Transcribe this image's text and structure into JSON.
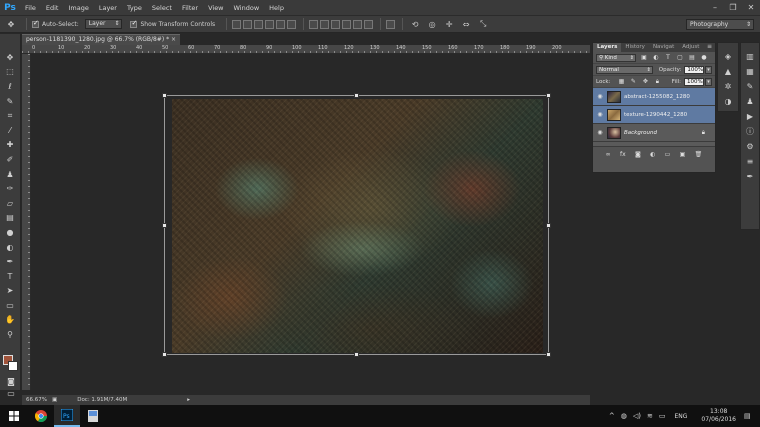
{
  "app": {
    "logo": "Ps"
  },
  "menu": [
    "File",
    "Edit",
    "Image",
    "Layer",
    "Type",
    "Select",
    "Filter",
    "View",
    "Window",
    "Help"
  ],
  "window_controls": [
    "–",
    "❐",
    "✕"
  ],
  "options_bar": {
    "auto_select_label": "Auto-Select:",
    "auto_select_target": "Layer",
    "show_transform_label": "Show Transform Controls",
    "workspace": "Photography"
  },
  "document": {
    "tab_title": "person-1181390_1280.jpg @ 66.7% (RGB/8#) *",
    "close": "×"
  },
  "ruler_numbers": [
    "0",
    "10",
    "20",
    "30",
    "40",
    "50",
    "60",
    "70",
    "80",
    "90",
    "100",
    "110",
    "120",
    "130",
    "140",
    "150",
    "160",
    "170",
    "180",
    "190",
    "200"
  ],
  "status": {
    "zoom": "66.67%",
    "doc_size": "Doc: 1.91M/7.40M"
  },
  "layers_panel": {
    "tabs": [
      "Layers",
      "History",
      "Navigat",
      "Adjust"
    ],
    "filter_kind": "Kind",
    "blend_mode": "Normal",
    "opacity_label": "Opacity:",
    "opacity_value": "100%",
    "lock_label": "Lock:",
    "fill_label": "Fill:",
    "fill_value": "100%",
    "layers": [
      {
        "name": "abstract-1255082_1280",
        "selected": true
      },
      {
        "name": "texture-1290442_1280",
        "selected": true
      },
      {
        "name": "Background",
        "selected": false,
        "locked": true
      }
    ]
  },
  "taskbar": {
    "language": "ENG",
    "time": "13:08",
    "date": "07/06/2016"
  },
  "colors": {
    "foreground": "#a0533a",
    "background": "#ffffff",
    "accent": "#31a8ff"
  }
}
